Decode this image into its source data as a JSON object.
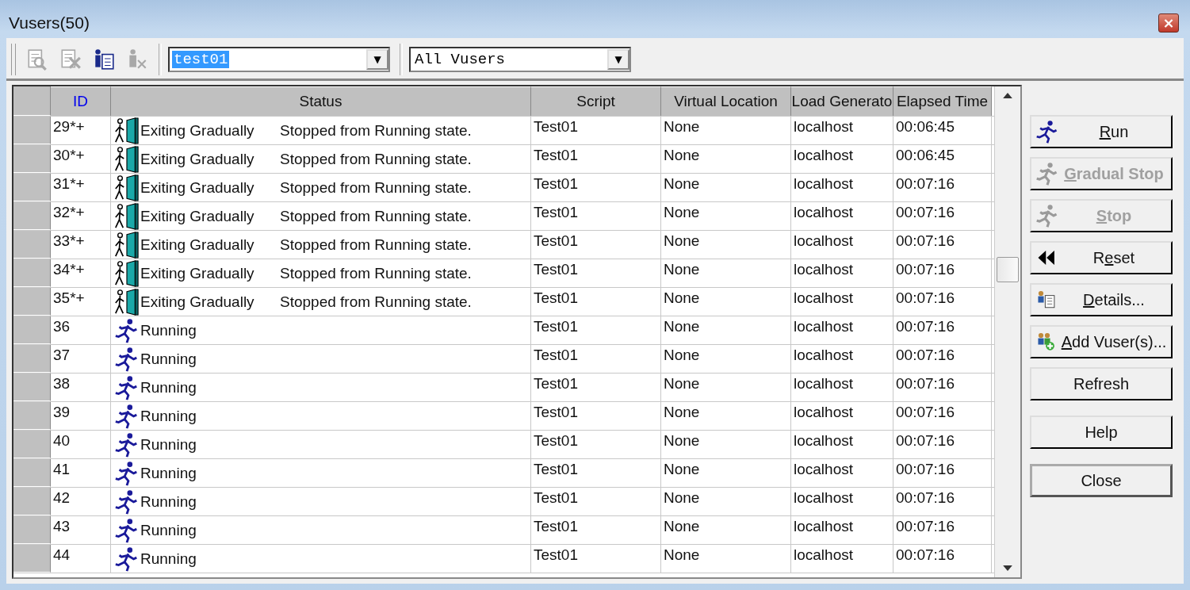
{
  "window": {
    "title": "Vusers(50)",
    "close": "×"
  },
  "toolbar": {
    "icons": [
      {
        "kind": "view",
        "disabled": true
      },
      {
        "kind": "remove",
        "disabled": true
      },
      {
        "kind": "info",
        "disabled": false
      },
      {
        "kind": "user-remove",
        "disabled": true
      }
    ],
    "script_combo": {
      "value": "test01",
      "highlighted": true,
      "arrow": "▼"
    },
    "filter_combo": {
      "value": "All Vusers",
      "highlighted": false,
      "arrow": "▼"
    }
  },
  "table": {
    "columns": [
      "ID",
      "Status",
      "Script",
      "Virtual Location",
      "Load Generato",
      "Elapsed Time"
    ],
    "rows": [
      {
        "id": "29*+",
        "kind": "exiting",
        "status": "Exiting Gradually",
        "message": "Stopped from Running state.",
        "script": "Test01",
        "location": "None",
        "generator": "localhost",
        "elapsed": "00:06:45"
      },
      {
        "id": "30*+",
        "kind": "exiting",
        "status": "Exiting Gradually",
        "message": "Stopped from Running state.",
        "script": "Test01",
        "location": "None",
        "generator": "localhost",
        "elapsed": "00:06:45"
      },
      {
        "id": "31*+",
        "kind": "exiting",
        "status": "Exiting Gradually",
        "message": "Stopped from Running state.",
        "script": "Test01",
        "location": "None",
        "generator": "localhost",
        "elapsed": "00:07:16"
      },
      {
        "id": "32*+",
        "kind": "exiting",
        "status": "Exiting Gradually",
        "message": "Stopped from Running state.",
        "script": "Test01",
        "location": "None",
        "generator": "localhost",
        "elapsed": "00:07:16"
      },
      {
        "id": "33*+",
        "kind": "exiting",
        "status": "Exiting Gradually",
        "message": "Stopped from Running state.",
        "script": "Test01",
        "location": "None",
        "generator": "localhost",
        "elapsed": "00:07:16"
      },
      {
        "id": "34*+",
        "kind": "exiting",
        "status": "Exiting Gradually",
        "message": "Stopped from Running state.",
        "script": "Test01",
        "location": "None",
        "generator": "localhost",
        "elapsed": "00:07:16"
      },
      {
        "id": "35*+",
        "kind": "exiting",
        "status": "Exiting Gradually",
        "message": "Stopped from Running state.",
        "script": "Test01",
        "location": "None",
        "generator": "localhost",
        "elapsed": "00:07:16"
      },
      {
        "id": "36",
        "kind": "running",
        "status": "Running",
        "script": "Test01",
        "location": "None",
        "generator": "localhost",
        "elapsed": "00:07:16"
      },
      {
        "id": "37",
        "kind": "running",
        "status": "Running",
        "script": "Test01",
        "location": "None",
        "generator": "localhost",
        "elapsed": "00:07:16"
      },
      {
        "id": "38",
        "kind": "running",
        "status": "Running",
        "script": "Test01",
        "location": "None",
        "generator": "localhost",
        "elapsed": "00:07:16"
      },
      {
        "id": "39",
        "kind": "running",
        "status": "Running",
        "script": "Test01",
        "location": "None",
        "generator": "localhost",
        "elapsed": "00:07:16"
      },
      {
        "id": "40",
        "kind": "running",
        "status": "Running",
        "script": "Test01",
        "location": "None",
        "generator": "localhost",
        "elapsed": "00:07:16"
      },
      {
        "id": "41",
        "kind": "running",
        "status": "Running",
        "script": "Test01",
        "location": "None",
        "generator": "localhost",
        "elapsed": "00:07:16"
      },
      {
        "id": "42",
        "kind": "running",
        "status": "Running",
        "script": "Test01",
        "location": "None",
        "generator": "localhost",
        "elapsed": "00:07:16"
      },
      {
        "id": "43",
        "kind": "running",
        "status": "Running",
        "script": "Test01",
        "location": "None",
        "generator": "localhost",
        "elapsed": "00:07:16"
      },
      {
        "id": "44",
        "kind": "running",
        "status": "Running",
        "script": "Test01",
        "location": "None",
        "generator": "localhost",
        "elapsed": "00:07:16"
      }
    ]
  },
  "buttons": [
    {
      "access_key": "R",
      "label_rest": "un",
      "kind": "run",
      "disabled": false,
      "default": false
    },
    {
      "access_key": "G",
      "label_rest": "radual Stop",
      "kind": "gradual",
      "disabled": true,
      "default": false
    },
    {
      "access_key": "S",
      "label_rest": "top",
      "kind": "stop",
      "disabled": true,
      "default": false
    },
    {
      "label_start": "R",
      "access_key": "e",
      "label_rest": "set",
      "kind": "reset",
      "disabled": false,
      "default": false
    },
    {
      "access_key": "D",
      "label_rest": "etails...",
      "kind": "details",
      "disabled": false,
      "default": false
    },
    {
      "access_key": "A",
      "label_rest": "dd Vuser(s)...",
      "kind": "add",
      "disabled": false,
      "default": false
    },
    {
      "label": "Refresh",
      "disabled": false,
      "default": false
    },
    {
      "label": "Help",
      "disabled": false,
      "default": false
    },
    {
      "label": "Close",
      "disabled": false,
      "default": true
    }
  ]
}
